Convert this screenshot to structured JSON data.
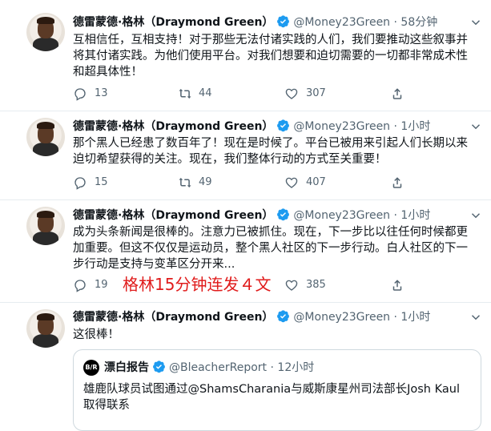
{
  "author": {
    "name": "德雷蒙德·格林（Draymond Green）",
    "handle": "@Money23Green",
    "verified": true
  },
  "tweets": [
    {
      "time": "58分钟",
      "text": "互相信任，互相支持！对于那些无法付诸实践的人们，我们要推动这些叙事并将其付诸实践。为他们使用平台。对我们想要和迫切需要的一切都非常成术性和超具体性！",
      "replies": "13",
      "retweets": "44",
      "likes": "307"
    },
    {
      "time": "1小时",
      "text": "那个黑人已经患了数百年了！现在是时候了。平台已被用来引起人们长期以来迫切希望获得的关注。现在，我们整体行动的方式至关重要！",
      "replies": "15",
      "retweets": "49",
      "likes": "407"
    },
    {
      "time": "1小时",
      "text": "成为头条新闻是很棒的。注意力已被抓住。现在，下一步比以往任何时候都更加重要。但这不仅仅是运动员，整个黑人社区的下一步行动。白人社区的下一步行动是支持与变革区分开来...",
      "replies": "19",
      "retweets": "",
      "likes": "385"
    },
    {
      "time": "1小时",
      "text": "这很棒！",
      "quote": {
        "avatar_text": "B/R",
        "name": "漂白报告",
        "handle": "@BleacherReport",
        "time": "12小时",
        "text": "雄鹿队球员试图通过@ShamsCharania与威斯康星州司法部长Josh Kaul取得联系"
      }
    }
  ],
  "overlay_caption": "格林15分钟连发４文",
  "colors": {
    "verified": "#1d9bf0",
    "overlay": "#e01b1b",
    "secondary_text": "#536471"
  }
}
